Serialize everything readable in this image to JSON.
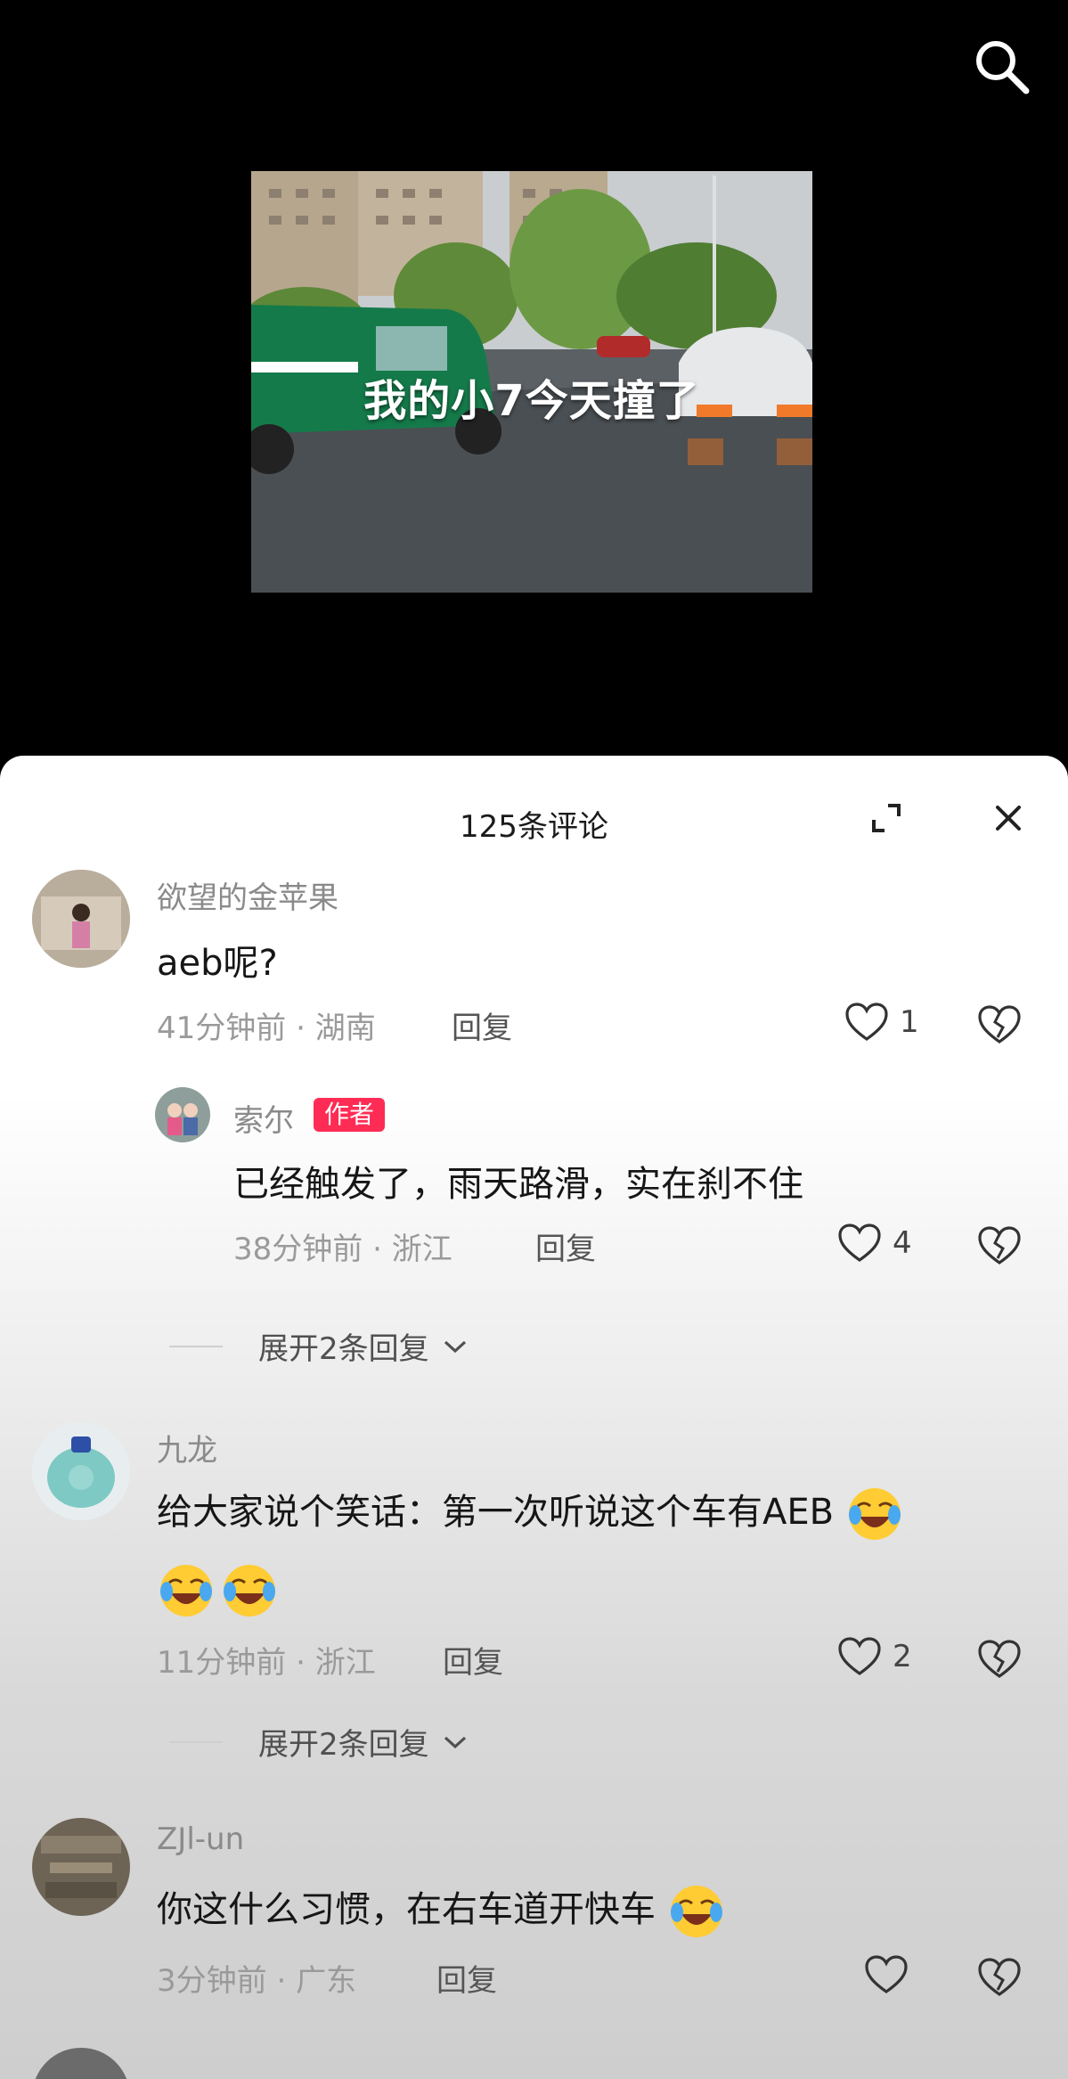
{
  "video": {
    "caption": "我的小7今天撞了"
  },
  "icons": {
    "search": "search-icon",
    "expand": "expand-icon",
    "close": "close-icon",
    "like": "heart-icon",
    "dislike": "broken-heart-icon",
    "emoji": "laughing-crying-emoji"
  },
  "colors": {
    "author_tag": "#fe2c55",
    "sheet_bg": "#ffffff"
  },
  "comments_panel": {
    "title": "125条评论"
  },
  "comments": [
    {
      "username": "欲望的金苹果",
      "text": "aeb呢?",
      "time": "41分钟前",
      "location": "湖南",
      "reply_label": "回复",
      "likes": "1",
      "replies": [
        {
          "username": "索尔",
          "tag": "作者",
          "text": "已经触发了，雨天路滑，实在刹不住",
          "time": "38分钟前",
          "location": "浙江",
          "reply_label": "回复",
          "likes": "4"
        }
      ],
      "expand_label": "展开2条回复"
    },
    {
      "username": "九龙",
      "text_line1": "给大家说个笑话：第一次听说这个车有AEB",
      "time": "11分钟前",
      "location": "浙江",
      "reply_label": "回复",
      "likes": "2",
      "expand_label": "展开2条回复"
    },
    {
      "username": "ZJl-un",
      "text": "你这什么习惯，在右车道开快车",
      "time": "3分钟前",
      "location": "广东",
      "reply_label": "回复",
      "likes": ""
    }
  ]
}
